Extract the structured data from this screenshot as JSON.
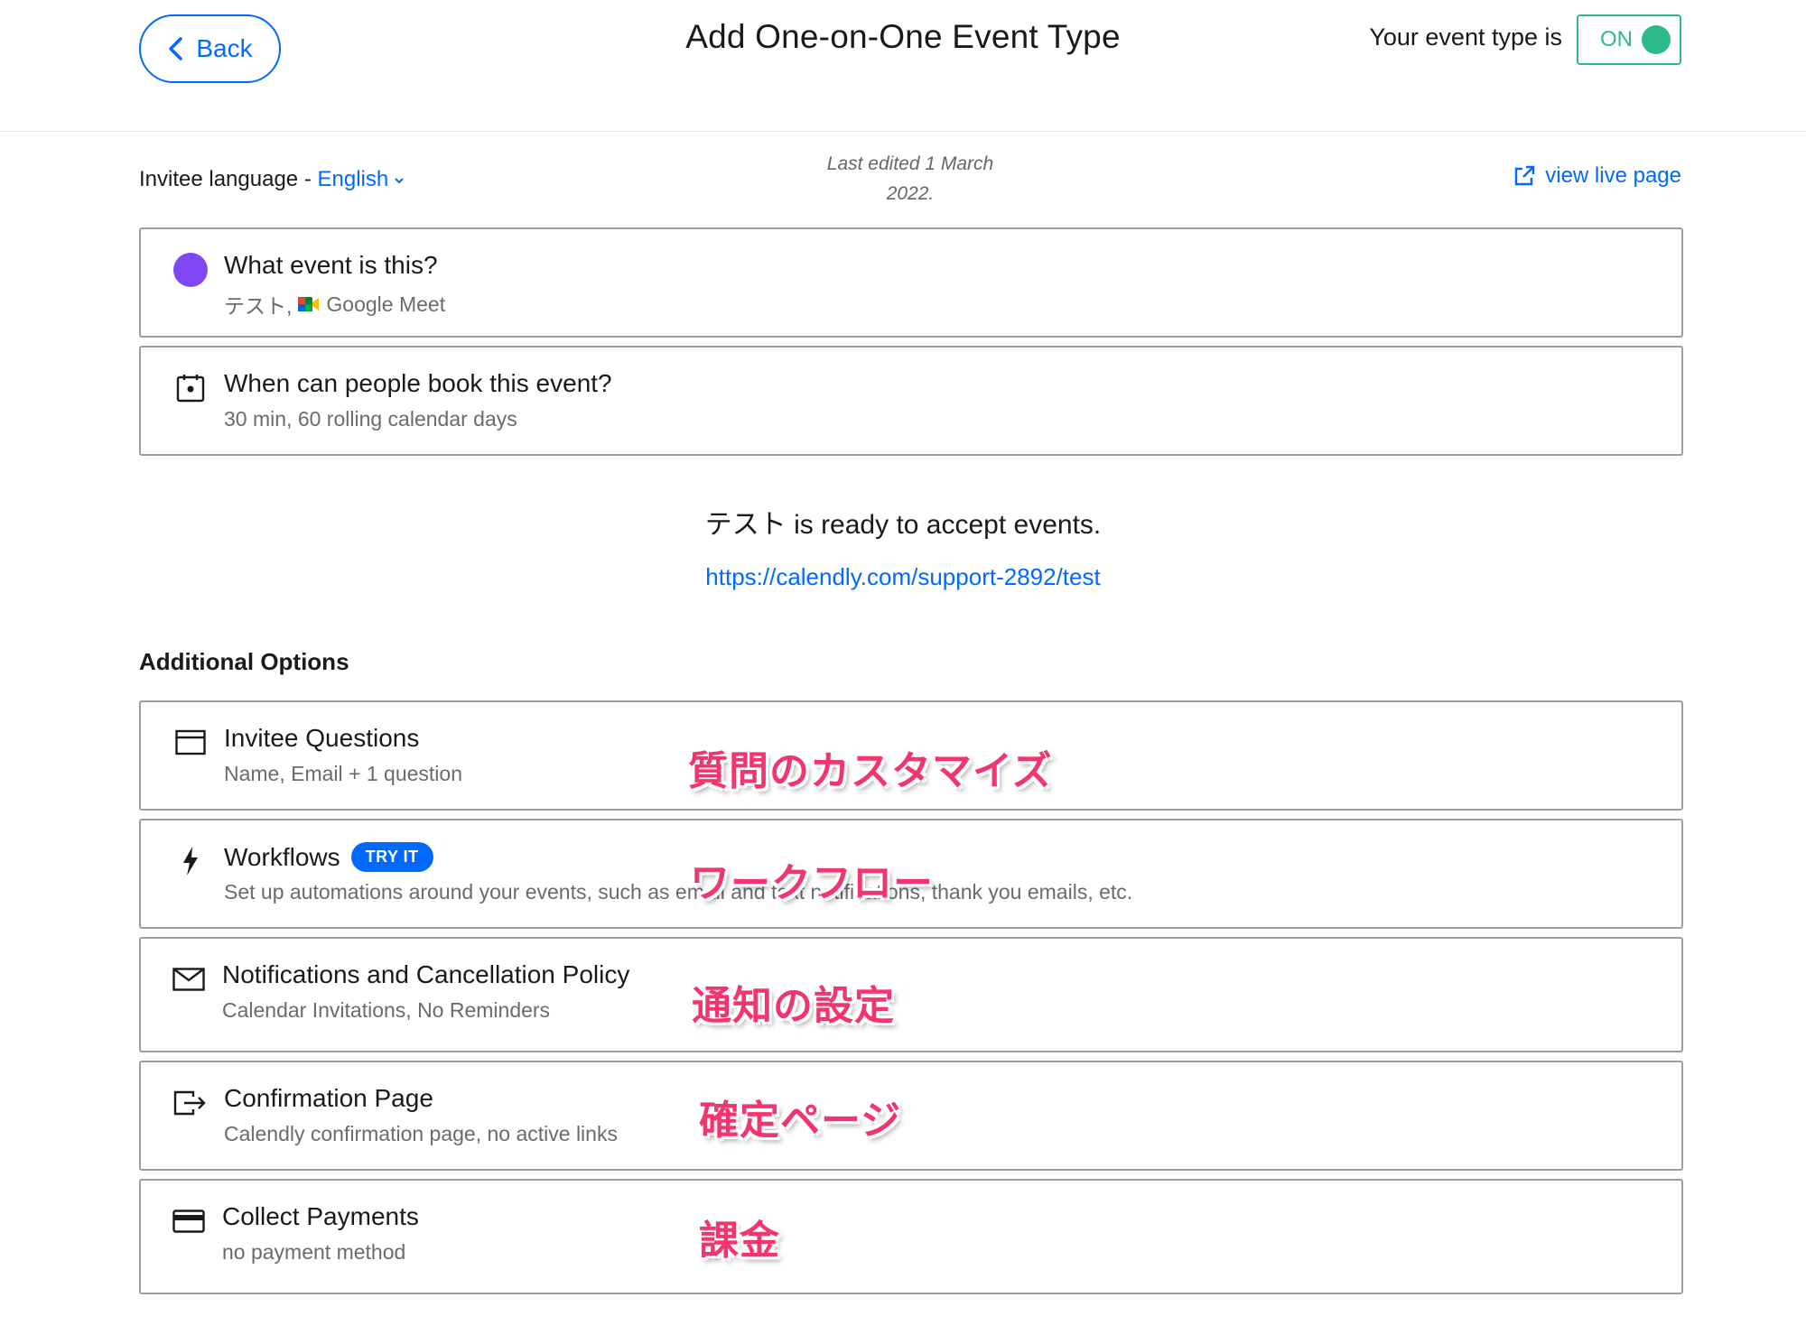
{
  "header": {
    "back_label": "Back",
    "title": "Add One-on-One Event Type",
    "status_label": "Your event type is",
    "toggle_label": "ON"
  },
  "subheader": {
    "language_prefix": "Invitee language - ",
    "language_value": "English",
    "last_edited": "Last edited 1 March 2022.",
    "view_live_label": "view live page"
  },
  "event_cards": [
    {
      "title": "What event is this?",
      "desc_name": "テスト,",
      "desc_location": "Google Meet",
      "icon": "purple-dot"
    },
    {
      "title": "When can people book this event?",
      "desc": "30 min, 60 rolling calendar days",
      "icon": "calendar-icon"
    }
  ],
  "ready": {
    "message": "テスト is ready to accept events.",
    "url": "https://calendly.com/support-2892/test"
  },
  "additional": {
    "title": "Additional Options",
    "items": [
      {
        "title": "Invitee Questions",
        "desc": "Name, Email + 1 question",
        "icon": "form-icon"
      },
      {
        "title": "Workflows",
        "badge": "TRY IT",
        "desc": "Set up automations around your events, such as email and text notifications, thank you emails, etc.",
        "icon": "lightning-icon"
      },
      {
        "title": "Notifications and Cancellation Policy",
        "desc": "Calendar Invitations, No Reminders",
        "icon": "envelope-icon"
      },
      {
        "title": "Confirmation Page",
        "desc": "Calendly confirmation page, no active links",
        "icon": "exit-icon"
      },
      {
        "title": "Collect Payments",
        "desc": "no payment method",
        "icon": "credit-card-icon"
      }
    ]
  },
  "annotations": [
    "質問のカスタマイズ",
    "ワークフロー",
    "通知の設定",
    "確定ページ",
    "課金"
  ],
  "colors": {
    "accent": "#0069ff",
    "on_green": "#2fb98a",
    "event_purple": "#8247f5",
    "annotation_pink": "#f2356d"
  }
}
